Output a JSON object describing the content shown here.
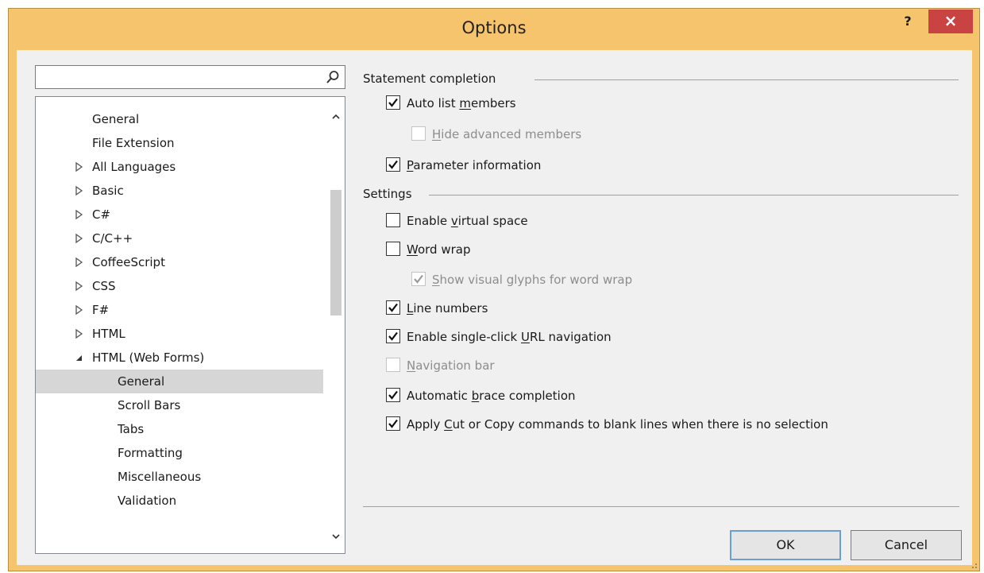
{
  "window": {
    "title": "Options",
    "help_label": "?",
    "close_label": "×"
  },
  "search": {
    "value": "",
    "placeholder": ""
  },
  "tree": {
    "items": [
      {
        "label": "General",
        "level": 0,
        "expander": "none",
        "selected": false
      },
      {
        "label": "File Extension",
        "level": 0,
        "expander": "none",
        "selected": false
      },
      {
        "label": "All Languages",
        "level": 0,
        "expander": "collapsed",
        "selected": false
      },
      {
        "label": "Basic",
        "level": 0,
        "expander": "collapsed",
        "selected": false
      },
      {
        "label": "C#",
        "level": 0,
        "expander": "collapsed",
        "selected": false
      },
      {
        "label": "C/C++",
        "level": 0,
        "expander": "collapsed",
        "selected": false
      },
      {
        "label": "CoffeeScript",
        "level": 0,
        "expander": "collapsed",
        "selected": false
      },
      {
        "label": "CSS",
        "level": 0,
        "expander": "collapsed",
        "selected": false
      },
      {
        "label": "F#",
        "level": 0,
        "expander": "collapsed",
        "selected": false
      },
      {
        "label": "HTML",
        "level": 0,
        "expander": "collapsed",
        "selected": false
      },
      {
        "label": "HTML (Web Forms)",
        "level": 0,
        "expander": "expanded",
        "selected": false
      },
      {
        "label": "General",
        "level": 1,
        "expander": "none",
        "selected": true
      },
      {
        "label": "Scroll Bars",
        "level": 1,
        "expander": "none",
        "selected": false
      },
      {
        "label": "Tabs",
        "level": 1,
        "expander": "none",
        "selected": false
      },
      {
        "label": "Formatting",
        "level": 1,
        "expander": "none",
        "selected": false
      },
      {
        "label": "Miscellaneous",
        "level": 1,
        "expander": "none",
        "selected": false
      },
      {
        "label": "Validation",
        "level": 1,
        "expander": "none",
        "selected": false
      }
    ]
  },
  "statement_completion": {
    "title": "Statement completion",
    "options": [
      {
        "pre": "Auto list ",
        "key": "m",
        "post": "embers",
        "checked": true,
        "disabled": false,
        "indent": 0
      },
      {
        "pre": "",
        "key": "H",
        "post": "ide advanced members",
        "checked": false,
        "disabled": true,
        "indent": 1
      },
      {
        "pre": "",
        "key": "P",
        "post": "arameter information",
        "checked": true,
        "disabled": false,
        "indent": 0
      }
    ]
  },
  "settings": {
    "title": "Settings",
    "options": [
      {
        "pre": "Enable ",
        "key": "v",
        "post": "irtual space",
        "checked": false,
        "disabled": false,
        "indent": 0
      },
      {
        "pre": "",
        "key": "W",
        "post": "ord wrap",
        "checked": false,
        "disabled": false,
        "indent": 0
      },
      {
        "pre": "",
        "key": "S",
        "post": "how visual glyphs for word wrap",
        "checked": true,
        "disabled": true,
        "indent": 1
      },
      {
        "pre": "",
        "key": "L",
        "post": "ine numbers",
        "checked": true,
        "disabled": false,
        "indent": 0
      },
      {
        "pre": "Enable single-click ",
        "key": "U",
        "post": "RL navigation",
        "checked": true,
        "disabled": false,
        "indent": 0
      },
      {
        "pre": "",
        "key": "N",
        "post": "avigation bar",
        "checked": false,
        "disabled": true,
        "indent": 0
      },
      {
        "pre": "Automatic ",
        "key": "b",
        "post": "race completion",
        "checked": true,
        "disabled": false,
        "indent": 0
      },
      {
        "pre": "Apply ",
        "key": "C",
        "post": "ut or Copy commands to blank lines when there is no selection",
        "checked": true,
        "disabled": false,
        "indent": 0
      }
    ]
  },
  "buttons": {
    "ok": "OK",
    "cancel": "Cancel"
  },
  "colors": {
    "title_bar": "#f6c46d",
    "close_button": "#c94343",
    "selection": "#d6d6d6"
  }
}
